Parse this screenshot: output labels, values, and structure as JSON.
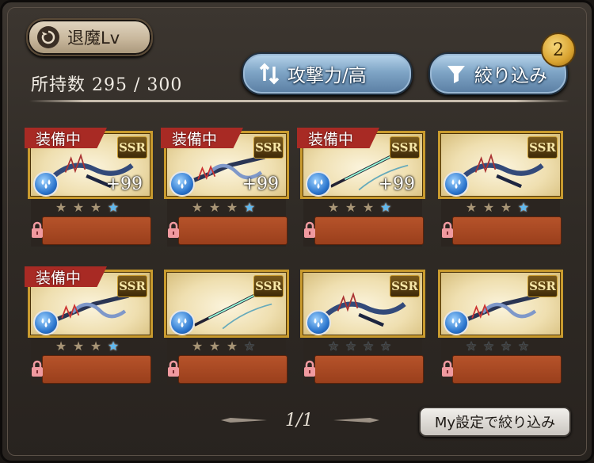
{
  "header": {
    "exorcism_label": "退魔Lv",
    "owned_label": "所持数",
    "owned_count": "295 / 300",
    "sort_label": "攻撃力/高",
    "filter_label": "絞り込み",
    "filter_badge": "2"
  },
  "cards": [
    {
      "equipped": "装備中",
      "rarity": "SSR",
      "level": "+99",
      "element": "water",
      "stars": [
        "gold",
        "gold",
        "gold",
        "blue"
      ]
    },
    {
      "equipped": "装備中",
      "rarity": "SSR",
      "level": "+99",
      "element": "water",
      "stars": [
        "gold",
        "gold",
        "gold",
        "blue"
      ]
    },
    {
      "equipped": "装備中",
      "rarity": "SSR",
      "level": "+99",
      "element": "water",
      "stars": [
        "gold",
        "gold",
        "gold",
        "blue"
      ]
    },
    {
      "equipped": "",
      "rarity": "SSR",
      "level": "",
      "element": "water",
      "stars": [
        "gold",
        "gold",
        "gold",
        "blue"
      ]
    },
    {
      "equipped": "装備中",
      "rarity": "SSR",
      "level": "",
      "element": "water",
      "stars": [
        "gold",
        "gold",
        "gold",
        "blue"
      ]
    },
    {
      "equipped": "",
      "rarity": "SSR",
      "level": "",
      "element": "water",
      "stars": [
        "gold",
        "gold",
        "gold",
        "dark"
      ]
    },
    {
      "equipped": "",
      "rarity": "SSR",
      "level": "",
      "element": "water",
      "stars": [
        "dark",
        "dark",
        "dark",
        "dark"
      ]
    },
    {
      "equipped": "",
      "rarity": "SSR",
      "level": "",
      "element": "water",
      "stars": [
        "dark",
        "dark",
        "dark",
        "dark"
      ]
    }
  ],
  "footer": {
    "page_indicator": "1/1",
    "my_filter_label": "My設定で絞り込み"
  },
  "colors": {
    "equip_ribbon": "#a82a24",
    "panel": "#b6532a",
    "gold_frame": "#c99b2e",
    "sort_button": "#7fa5c6"
  }
}
